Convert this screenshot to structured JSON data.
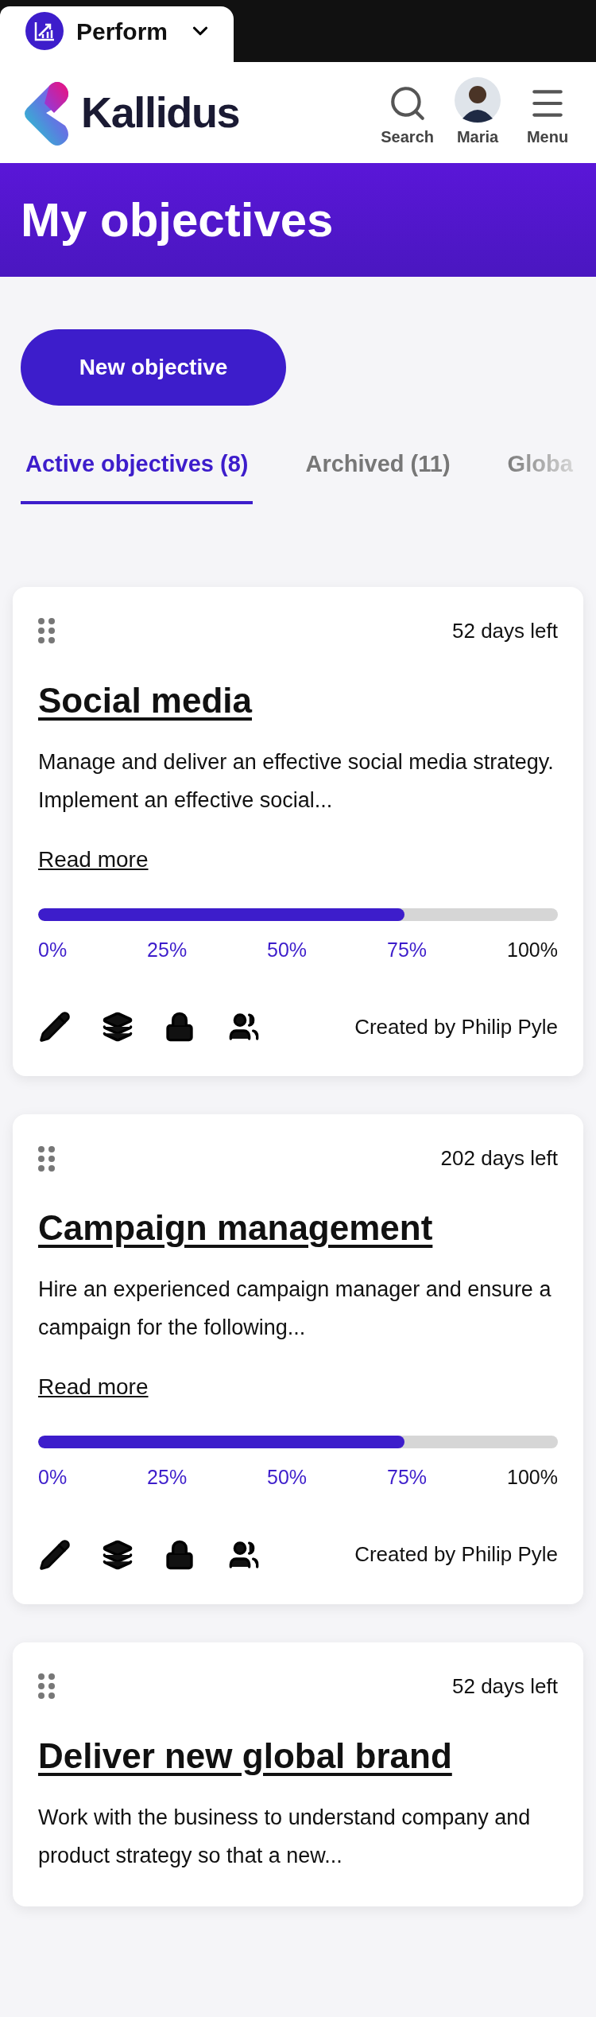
{
  "app_switcher": {
    "label": "Perform"
  },
  "header": {
    "logo": "Kallidus",
    "actions": [
      {
        "kind": "search",
        "label": "Search"
      },
      {
        "kind": "avatar",
        "label": "Maria"
      },
      {
        "kind": "menu",
        "label": "Menu"
      }
    ]
  },
  "page_title": "My objectives",
  "new_button": "New objective",
  "tabs": [
    {
      "label": "Active objectives (8)",
      "selected": true
    },
    {
      "label": "Archived (11)",
      "selected": false
    },
    {
      "label": "Globa",
      "selected": false
    }
  ],
  "objectives": [
    {
      "days_left": "52 days left",
      "title": "Social media",
      "description": "Manage and deliver an effective social media strategy. Implement an effective social...",
      "read_more": "Read more",
      "level": 0.705,
      "ticks": [
        {
          "label": "0%",
          "reached": true
        },
        {
          "label": "25%",
          "reached": true
        },
        {
          "label": "50%",
          "reached": true
        },
        {
          "label": "75%",
          "reached": true
        },
        {
          "label": "100%",
          "reached": false
        }
      ],
      "created_by": "Created by Philip Pyle"
    },
    {
      "days_left": "202 days left",
      "title": "Campaign management",
      "description": "Hire an experienced campaign manager and ensure a campaign for the following...",
      "read_more": "Read more",
      "level": 0.705,
      "ticks": [
        {
          "label": "0%",
          "reached": true
        },
        {
          "label": "25%",
          "reached": true
        },
        {
          "label": "50%",
          "reached": true
        },
        {
          "label": "75%",
          "reached": true
        },
        {
          "label": "100%",
          "reached": false
        }
      ],
      "created_by": "Created by Philip Pyle"
    },
    {
      "days_left": "52 days left",
      "title": "Deliver new global brand",
      "description": "Work with the business to understand company and product strategy so that a new..."
    }
  ]
}
